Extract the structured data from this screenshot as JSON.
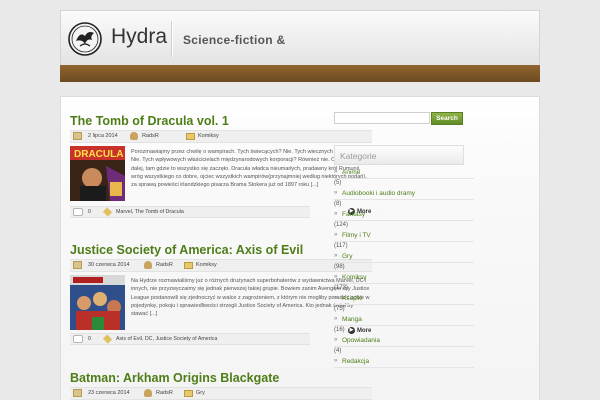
{
  "header": {
    "site_title": "Hydra",
    "tagline": "Science-fiction &"
  },
  "posts": [
    {
      "title": "The Tomb of Dracula vol. 1",
      "date": "2 lipca 2014",
      "author": "RadsR",
      "category": "Komiksy",
      "excerpt": "Porozmawiajmy przez chwilę o wampirach. Tych świecących? Nie. Tych wiecznych buntowników? Nie. Tych wpływowych właścicielach międzynarodowych korporacji? Również nie. Cofnijmy się dalej, tam gdzie to wszystko się zaczęło. Dracula władca nieumarłych, pradawny król Rumunii, wróg wszystkiego co dobre, ojciec wszystkich wampirów(przynajmniej według niektórych podań), za sprawą powieści irlandzkiego pisarza Brama Stokera już od 1897 roku [...]",
      "comments": "0",
      "tags": "Marvel, The Tomb of Dracula",
      "more": "More"
    },
    {
      "title": "Justice Society of America: Axis of Evil",
      "date": "30 czerwca 2014",
      "author": "RadsR",
      "category": "Komiksy",
      "excerpt": "Na Hydrze rozmawialiśmy już o różnych drużynach superbohaterów z wydawnictwa Marvel, DC i innych, nie przyzwyczaimy się jednak pierwszej takiej grupie. Bowiem zanim Avengers czy Justice League postanowili się zjednoczyć w walce z zagrożeniem, z którym nie mogliby poradzić sobie w pojedynkę, pokoju i sprawiedliwości strzegli Justice Society of America. Kto jednak śmiał by stawać [...]",
      "comments": "0",
      "tags": "Axis of Evil, DC, Justice Society of America",
      "more": "More"
    },
    {
      "title": "Batman: Arkham Origins Blackgate",
      "date": "23 czerwca 2014",
      "author": "RadsR",
      "category": "Gry"
    }
  ],
  "sidebar": {
    "search_placeholder": "",
    "search_button": "Search",
    "categories_title": "Kategorie",
    "categories": [
      {
        "name": "Anime",
        "count": "(5)"
      },
      {
        "name": "Audiobooki i audio dramy",
        "count": "(8)"
      },
      {
        "name": "Fantasy",
        "count": "(124)"
      },
      {
        "name": "Filmy i TV",
        "count": "(117)"
      },
      {
        "name": "Gry",
        "count": "(98)"
      },
      {
        "name": "Komiksy",
        "count": "(173)"
      },
      {
        "name": "Książki",
        "count": "(75)"
      },
      {
        "name": "Manga",
        "count": "(16)"
      },
      {
        "name": "Opowiadania",
        "count": "(4)"
      },
      {
        "name": "Redakcja",
        "count": ""
      }
    ]
  },
  "icons": {
    "logo": "dragon-logo-icon",
    "date": "calendar-icon",
    "author": "user-icon",
    "category": "folder-icon",
    "comments": "comment-icon",
    "tags": "tag-icon",
    "more": "arrow-right-icon",
    "cat_bullet": "double-chevron-right-icon"
  },
  "colors": {
    "accent_green": "#4e7d18",
    "brown_bar": "#7a5428",
    "search_button": "#6f9a2e"
  }
}
